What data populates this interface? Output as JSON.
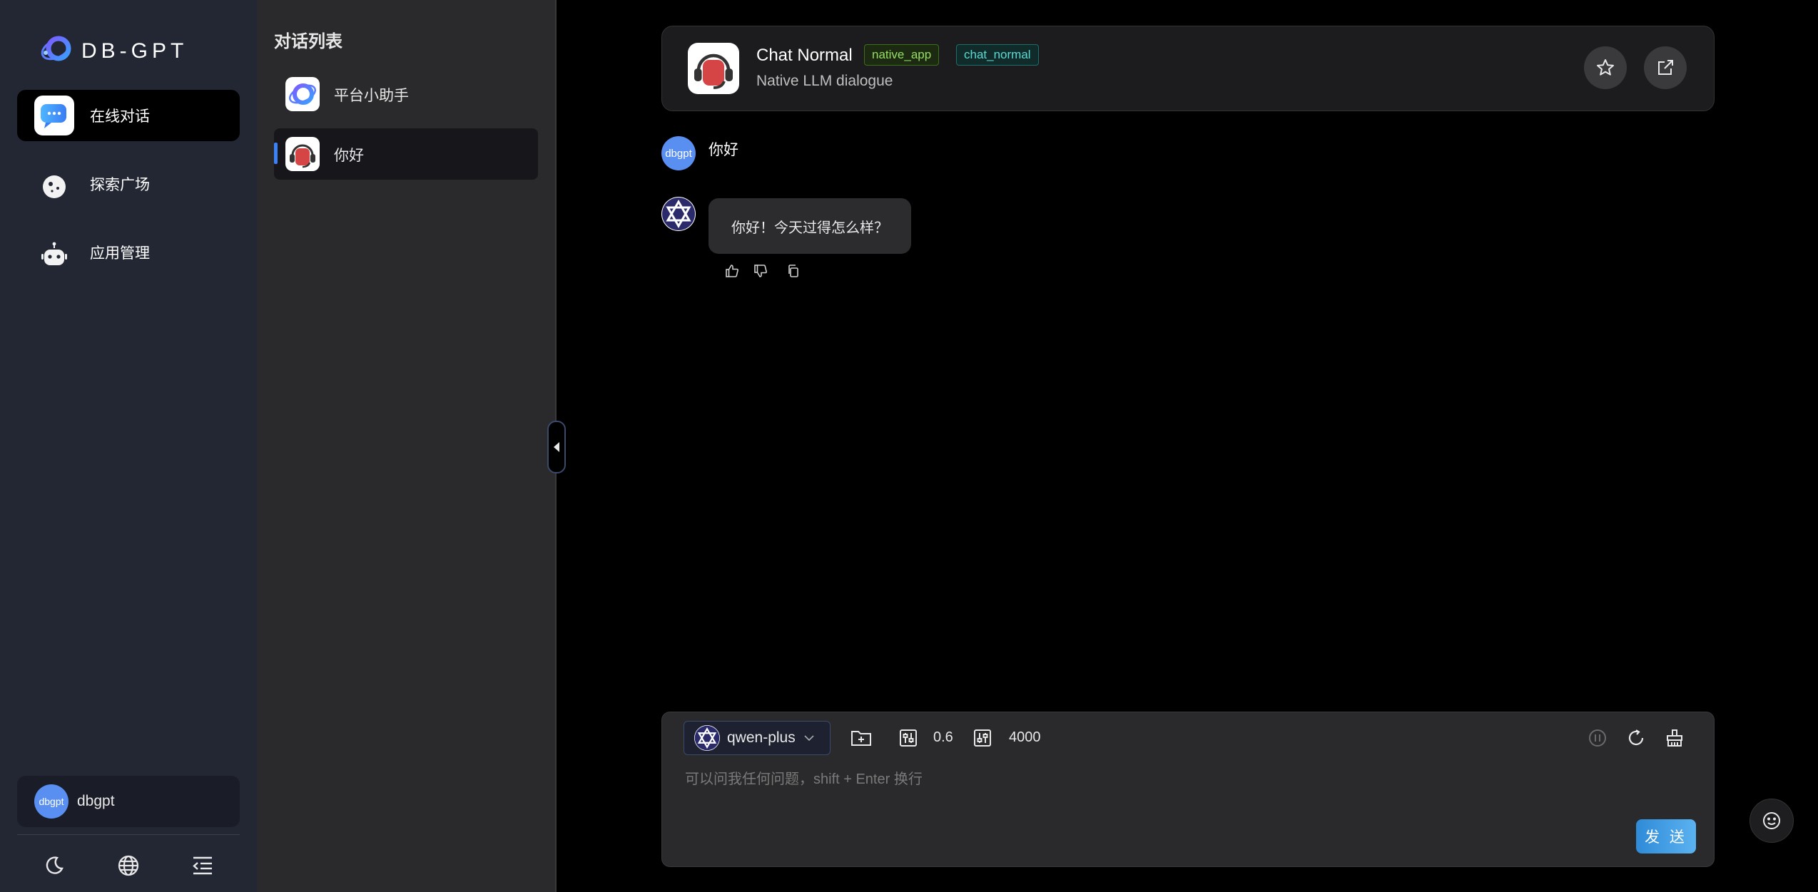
{
  "brand": {
    "logo_text": "DB-GPT"
  },
  "nav": {
    "items": [
      {
        "label": "在线对话",
        "icon": "chat-bubble-icon",
        "active": true
      },
      {
        "label": "探索广场",
        "icon": "explore-icon",
        "active": false
      },
      {
        "label": "应用管理",
        "icon": "robot-icon",
        "active": false
      }
    ],
    "user": {
      "avatar_text": "dbgpt",
      "name": "dbgpt"
    },
    "bottom_icons": [
      "moon-icon",
      "globe-icon",
      "menu-fold-icon"
    ]
  },
  "conversations": {
    "title": "对话列表",
    "items": [
      {
        "label": "平台小助手",
        "icon": "dbgpt-logo-icon",
        "active": false
      },
      {
        "label": "你好",
        "icon": "chat-normal-app-icon",
        "active": true
      }
    ]
  },
  "chat": {
    "app_name": "Chat Normal",
    "tags": [
      "native_app",
      "chat_normal"
    ],
    "description": "Native LLM dialogue",
    "messages": [
      {
        "role": "user",
        "avatar_text": "dbgpt",
        "text": "你好"
      },
      {
        "role": "assistant",
        "text": "你好！今天过得怎么样？"
      }
    ]
  },
  "input": {
    "model": "qwen-plus",
    "temperature": "0.6",
    "max_tokens": "4000",
    "placeholder": "可以问我任何问题，shift + Enter 换行",
    "value": "",
    "send_label": "发 送"
  },
  "colors": {
    "accent": "#3b82f6",
    "nav_bg": "#232734",
    "list_bg": "#2a2a2c",
    "tag_green": "#95de64",
    "tag_cyan": "#5cdbd3"
  }
}
